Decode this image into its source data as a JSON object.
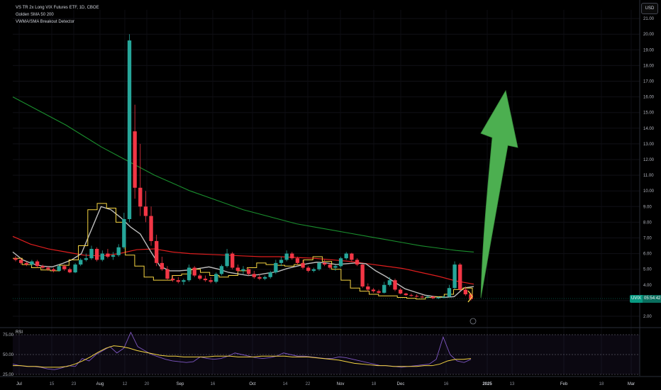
{
  "header": {
    "title": "VS TR 2x Long VIX Futures ETF, 1D, CBOE",
    "indicator_1": "Golden SMA 50 200",
    "indicator_2": "VWMA/SMA Breakout Detector"
  },
  "currency_button": "USD",
  "last_price": {
    "symbol": "UVIX",
    "countdown": "05:54:42"
  },
  "rsi_label": "RSI",
  "colors": {
    "up": "#26a69a",
    "down": "#f23645",
    "sma200": "#1a8f2e",
    "sma50": "#e01e1e",
    "vwma": "#bdbdbd",
    "breakout": "#f5d442",
    "arrow": "#4caf50",
    "rsi_line": "#7e57c2",
    "rsi_ma": "#f5d442"
  },
  "chart_data": {
    "type": "candlestick",
    "ylim": [
      2,
      21
    ],
    "y_ticks": [
      "2.00",
      "3.00",
      "4.00",
      "5.00",
      "6.00",
      "7.00",
      "8.00",
      "9.00",
      "10.00",
      "11.00",
      "12.00",
      "13.00",
      "14.00",
      "15.00",
      "16.00",
      "17.00",
      "18.00",
      "19.00",
      "20.00",
      "21.00"
    ],
    "x_ticks": [
      "Jul",
      "15",
      "23",
      "Aug",
      "12",
      "20",
      "Sep",
      "16",
      "Oct",
      "14",
      "22",
      "Nov",
      "18",
      "Dec",
      "16",
      "2025",
      "13",
      "Feb",
      "18",
      "Mar"
    ],
    "candles": [
      [
        5.7,
        5.85,
        5.5,
        5.6
      ],
      [
        5.6,
        5.7,
        5.3,
        5.4
      ],
      [
        5.4,
        5.5,
        5.2,
        5.3
      ],
      [
        5.3,
        5.6,
        5.2,
        5.5
      ],
      [
        5.5,
        5.6,
        5.1,
        5.2
      ],
      [
        5.2,
        5.3,
        5.0,
        5.1
      ],
      [
        5.1,
        5.2,
        4.9,
        5.0
      ],
      [
        5.0,
        5.1,
        4.8,
        4.9
      ],
      [
        4.9,
        5.3,
        4.85,
        5.2
      ],
      [
        5.2,
        5.3,
        4.9,
        5.0
      ],
      [
        5.0,
        5.1,
        4.75,
        4.8
      ],
      [
        4.8,
        5.4,
        4.75,
        5.3
      ],
      [
        5.3,
        5.7,
        5.2,
        5.6
      ],
      [
        5.6,
        6.0,
        5.5,
        5.7
      ],
      [
        5.7,
        6.5,
        5.6,
        6.3
      ],
      [
        6.3,
        6.4,
        5.5,
        5.6
      ],
      [
        5.6,
        6.2,
        5.5,
        6.0
      ],
      [
        6.0,
        6.3,
        5.7,
        5.8
      ],
      [
        5.8,
        6.1,
        5.6,
        5.9
      ],
      [
        5.9,
        6.6,
        5.8,
        6.4
      ],
      [
        6.4,
        8.6,
        6.3,
        8.2
      ],
      [
        8.2,
        20.0,
        8.0,
        19.6
      ],
      [
        13.8,
        15.5,
        9.5,
        10.2
      ],
      [
        10.2,
        13.0,
        8.4,
        9.0
      ],
      [
        9.0,
        10.0,
        8.0,
        8.4
      ],
      [
        8.4,
        9.0,
        6.5,
        6.8
      ],
      [
        6.8,
        7.2,
        5.2,
        5.4
      ],
      [
        5.4,
        5.8,
        4.9,
        5.0
      ],
      [
        5.0,
        5.2,
        4.3,
        4.4
      ],
      [
        4.4,
        4.6,
        4.2,
        4.3
      ],
      [
        4.3,
        4.5,
        4.1,
        4.2
      ],
      [
        4.2,
        4.4,
        4.0,
        4.3
      ],
      [
        4.3,
        5.3,
        4.2,
        5.1
      ],
      [
        5.1,
        5.2,
        4.5,
        4.6
      ],
      [
        4.6,
        4.7,
        4.3,
        4.4
      ],
      [
        4.4,
        4.6,
        4.2,
        4.3
      ],
      [
        4.3,
        4.5,
        4.1,
        4.2
      ],
      [
        4.2,
        4.8,
        4.1,
        4.7
      ],
      [
        4.7,
        5.3,
        4.6,
        5.2
      ],
      [
        5.2,
        6.3,
        5.1,
        6.0
      ],
      [
        6.0,
        6.1,
        5.0,
        5.1
      ],
      [
        5.1,
        5.3,
        4.8,
        4.9
      ],
      [
        4.9,
        5.2,
        4.7,
        5.0
      ],
      [
        5.0,
        5.1,
        4.6,
        4.7
      ],
      [
        4.7,
        4.9,
        4.4,
        4.5
      ],
      [
        4.5,
        4.7,
        4.3,
        4.4
      ],
      [
        4.4,
        4.6,
        4.3,
        4.5
      ],
      [
        4.5,
        4.9,
        4.4,
        4.8
      ],
      [
        4.8,
        5.6,
        4.7,
        5.4
      ],
      [
        5.4,
        5.8,
        5.2,
        5.6
      ],
      [
        5.6,
        6.2,
        5.5,
        6.0
      ],
      [
        6.0,
        6.1,
        5.6,
        5.7
      ],
      [
        5.7,
        5.8,
        5.3,
        5.4
      ],
      [
        5.4,
        5.6,
        5.0,
        5.1
      ],
      [
        5.1,
        5.2,
        4.8,
        4.9
      ],
      [
        4.9,
        5.1,
        4.8,
        5.0
      ],
      [
        5.0,
        5.5,
        4.9,
        5.4
      ],
      [
        5.4,
        5.6,
        5.2,
        5.3
      ],
      [
        5.3,
        5.4,
        5.0,
        5.1
      ],
      [
        5.1,
        5.3,
        4.9,
        5.2
      ],
      [
        5.2,
        5.8,
        5.1,
        5.7
      ],
      [
        5.7,
        6.1,
        5.6,
        6.0
      ],
      [
        6.0,
        6.05,
        5.5,
        5.6
      ],
      [
        5.6,
        5.7,
        5.2,
        5.3
      ],
      [
        5.3,
        5.35,
        3.8,
        3.9
      ],
      [
        3.9,
        4.1,
        3.6,
        3.7
      ],
      [
        3.7,
        3.8,
        3.5,
        3.6
      ],
      [
        3.6,
        3.7,
        3.45,
        3.5
      ],
      [
        3.5,
        4.2,
        3.45,
        4.0
      ],
      [
        4.0,
        4.5,
        3.9,
        4.3
      ],
      [
        4.3,
        4.4,
        3.6,
        3.7
      ],
      [
        3.7,
        3.8,
        3.4,
        3.45
      ],
      [
        3.45,
        3.5,
        3.3,
        3.35
      ],
      [
        3.35,
        3.45,
        3.25,
        3.3
      ],
      [
        3.3,
        3.4,
        3.2,
        3.25
      ],
      [
        3.25,
        3.35,
        3.15,
        3.2
      ],
      [
        3.2,
        3.3,
        3.15,
        3.25
      ],
      [
        3.25,
        3.3,
        3.1,
        3.15
      ],
      [
        3.15,
        3.25,
        3.1,
        3.2
      ],
      [
        3.2,
        3.3,
        3.15,
        3.25
      ],
      [
        3.25,
        4.0,
        3.2,
        3.8
      ],
      [
        3.8,
        5.5,
        3.7,
        5.3
      ],
      [
        5.3,
        5.4,
        3.6,
        3.7
      ],
      [
        3.7,
        3.9,
        3.3,
        3.4
      ],
      [
        3.4,
        3.5,
        3.0,
        3.1
      ]
    ],
    "series": [
      {
        "name": "Golden SMA 50 200",
        "values": [
          16.0,
          15.4,
          14.8,
          14.2,
          13.5,
          12.8,
          12.2,
          11.6,
          11.0,
          10.5,
          10.0,
          9.6,
          9.2,
          8.8,
          8.5,
          8.2,
          7.9,
          7.7,
          7.5,
          7.3,
          7.1,
          6.9,
          6.7,
          6.5,
          6.35,
          6.2,
          6.1
        ]
      },
      {
        "name": "Golden SMA 50 200",
        "values": [
          7.1,
          6.6,
          6.3,
          6.1,
          5.9,
          5.85,
          6.0,
          6.25,
          6.3,
          6.1,
          6.0,
          5.95,
          5.9,
          5.85,
          5.8,
          5.8,
          5.75,
          5.7,
          5.6,
          5.5,
          5.35,
          5.2,
          5.05,
          4.8,
          4.55,
          4.25,
          4.05
        ]
      },
      {
        "name": "VWMA/SMA Breakout Detector",
        "values": [
          6.1,
          5.6,
          5.35,
          5.2,
          5.15,
          5.35,
          5.6,
          6.0,
          7.5,
          9.0,
          8.8,
          8.3,
          7.7,
          7.25,
          6.2,
          5.2,
          4.9,
          4.9,
          4.95,
          5.05,
          5.15,
          5.0,
          4.8,
          4.7,
          4.6,
          4.65,
          4.75,
          4.85,
          5.05,
          5.2,
          5.35,
          5.45,
          5.4,
          5.3,
          5.35,
          5.4,
          5.35,
          4.9,
          4.55,
          4.15,
          3.75,
          3.55,
          3.35,
          3.25,
          3.2,
          3.25,
          3.8,
          3.9
        ]
      },
      {
        "name": "VWMA/SMA Breakout Detector",
        "values": [
          5.7,
          5.3,
          5.1,
          4.95,
          4.9,
          5.25,
          5.6,
          6.5,
          8.8,
          9.2,
          8.9,
          8.0,
          5.9,
          5.2,
          4.5,
          4.3,
          4.3,
          4.6,
          4.7,
          5.0,
          4.8,
          4.6,
          4.5,
          4.6,
          4.9,
          5.1,
          5.4,
          5.3,
          5.25,
          5.2,
          5.3,
          5.6,
          5.8,
          5.5,
          5.0,
          4.3,
          3.8,
          3.6,
          3.4,
          3.3,
          3.3,
          3.2,
          3.15,
          3.1,
          3.2,
          3.25,
          3.4,
          3.7,
          3.8,
          3.3
        ]
      }
    ],
    "rsi": {
      "ylim": [
        25,
        75
      ],
      "y_ticks": [
        "75.00",
        "50.00",
        "25.00"
      ],
      "rsi_values": [
        38,
        36,
        35,
        35,
        34,
        32,
        31,
        33,
        36,
        35,
        45,
        42,
        50,
        55,
        60,
        52,
        58,
        78,
        60,
        55,
        50,
        47,
        44,
        42,
        41,
        40,
        41,
        47,
        45,
        44,
        45,
        48,
        52,
        50,
        48,
        46,
        45,
        46,
        48,
        52,
        50,
        48,
        48,
        47,
        46,
        45,
        45,
        47,
        46,
        44,
        42,
        40,
        38,
        36,
        36,
        35,
        34,
        35,
        36,
        37,
        38,
        44,
        72,
        50,
        42,
        40,
        44
      ],
      "ma_values": [
        36,
        36,
        35,
        35,
        34,
        34,
        34,
        35,
        38,
        42,
        47,
        53,
        58,
        61,
        60,
        58,
        55,
        53,
        51,
        49,
        48,
        48,
        47,
        47,
        47,
        47,
        48,
        48,
        48,
        47,
        47,
        47,
        48,
        48,
        48,
        48,
        47,
        47,
        47,
        46,
        45,
        44,
        43,
        41,
        39,
        38,
        37,
        36,
        36,
        35,
        35,
        35,
        35,
        36,
        36,
        38,
        42,
        44,
        44,
        45
      ]
    }
  }
}
